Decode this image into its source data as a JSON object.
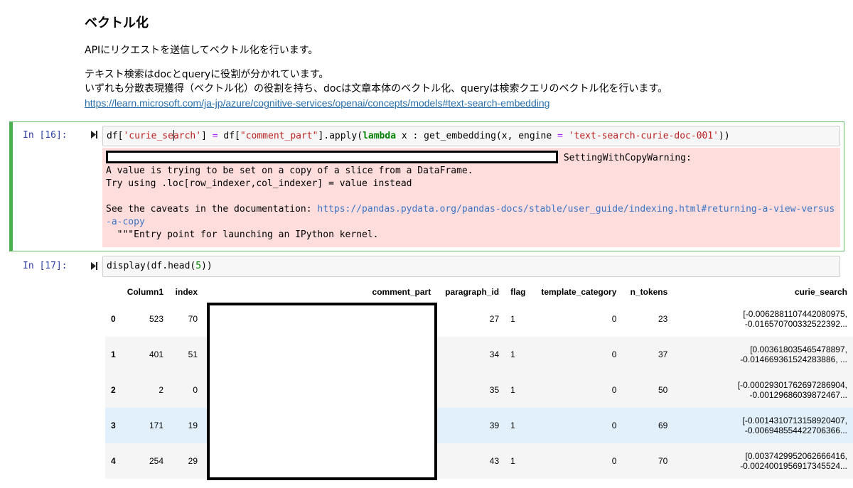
{
  "markdown": {
    "heading": "ベクトル化",
    "para1": "APIにリクエストを送信してベクトル化を行います。",
    "para2_line1": "テキスト検索はdocとqueryに役割が分かれています。",
    "para2_line2": "いずれも分散表現獲得（ベクトル化）の役割を持ち、docは文章本体のベクトル化、queryは検索クエリのベクトル化を行います。",
    "link": "https://learn.microsoft.com/ja-jp/azure/cognitive-services/openai/concepts/models#text-search-embedding"
  },
  "cell16": {
    "prompt": "In [16]:",
    "code": {
      "p1": "df[",
      "s1a": "'curie_se",
      "s1b": "arch'",
      "p2": "] ",
      "op1": "=",
      "p3": " df[",
      "s2": "\"comment_part\"",
      "p4": "].apply(",
      "kw": "lambda",
      "p5": " x : get_embedding(x, engine ",
      "op2": "=",
      "p6": " ",
      "s3": "'text-search-curie-doc-001'",
      "p7": "))"
    },
    "stderr": {
      "warning": " SettingWithCopyWarning:",
      "line1": "A value is trying to be set on a copy of a slice from a DataFrame.",
      "line2": "Try using .loc[row_indexer,col_indexer] = value instead",
      "line3_prefix": "See the caveats in the documentation: ",
      "line3_link": "https://pandas.pydata.org/pandas-docs/stable/user_guide/indexing.html#returning-a-view-versus-a-copy",
      "line4": "  \"\"\"Entry point for launching an IPython kernel."
    }
  },
  "cell17": {
    "prompt": "In [17]:",
    "code": {
      "p1": "display(df.head(",
      "num": "5",
      "p2": "))"
    }
  },
  "table": {
    "columns": [
      "",
      "Column1",
      "index",
      "comment_part",
      "paragraph_id",
      "flag",
      "template_category",
      "n_tokens",
      "curie_search"
    ],
    "rows": [
      {
        "idx": "0",
        "Column1": "523",
        "index": "70",
        "comment_part": "",
        "paragraph_id": "27",
        "flag": "1",
        "template_category": "0",
        "n_tokens": "23",
        "curie_1": "[-0.0062881107442080975,",
        "curie_2": "-0.016570700332522392..."
      },
      {
        "idx": "1",
        "Column1": "401",
        "index": "51",
        "comment_part": "",
        "paragraph_id": "34",
        "flag": "1",
        "template_category": "0",
        "n_tokens": "37",
        "curie_1": "[0.003618035465478897,",
        "curie_2": "-0.014669361524283886, ..."
      },
      {
        "idx": "2",
        "Column1": "2",
        "index": "0",
        "comment_part": "",
        "paragraph_id": "35",
        "flag": "1",
        "template_category": "0",
        "n_tokens": "50",
        "curie_1": "[-0.00029301762697286904,",
        "curie_2": "-0.00129686039872467..."
      },
      {
        "idx": "3",
        "Column1": "171",
        "index": "19",
        "comment_part": "",
        "paragraph_id": "39",
        "flag": "1",
        "template_category": "0",
        "n_tokens": "69",
        "curie_1": "[-0.0014310713158920407,",
        "curie_2": "-0.006948554422706366..."
      },
      {
        "idx": "4",
        "Column1": "254",
        "index": "29",
        "comment_part": "",
        "paragraph_id": "43",
        "flag": "1",
        "template_category": "0",
        "n_tokens": "70",
        "curie_1": "[0.0037429952062666416,",
        "curie_2": "-0.0024001956917345524..."
      }
    ]
  },
  "icons": {
    "run": "run-cell-icon"
  }
}
